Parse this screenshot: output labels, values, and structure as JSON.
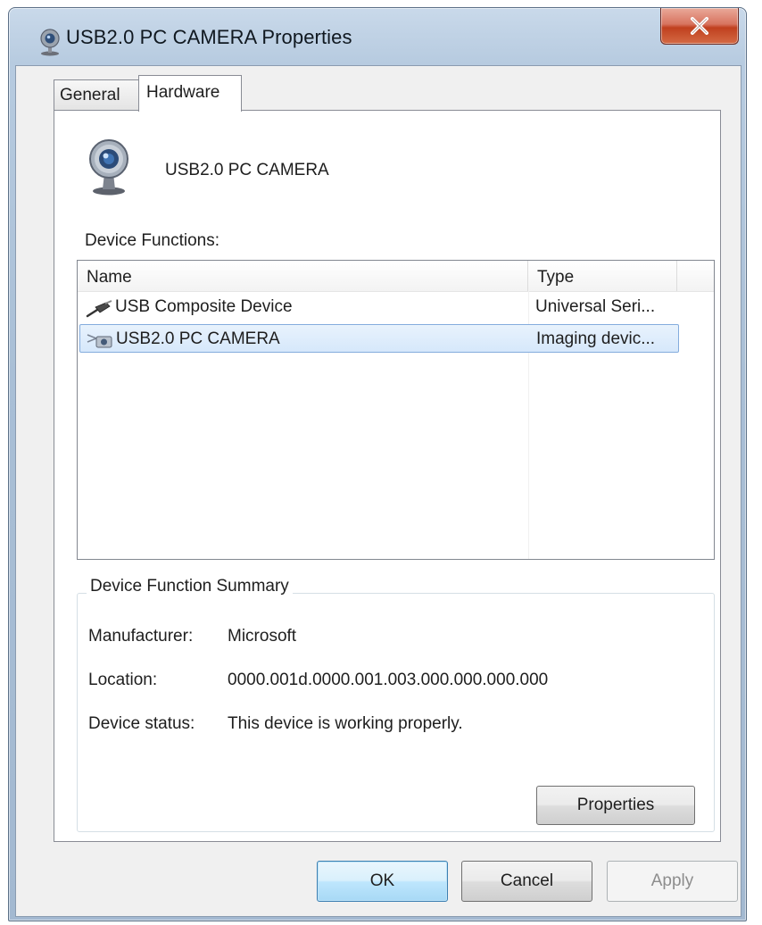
{
  "window": {
    "title": "USB2.0 PC CAMERA Properties",
    "close_label": "X"
  },
  "tabs": [
    {
      "label": "General",
      "active": false
    },
    {
      "label": "Hardware",
      "active": true
    }
  ],
  "device": {
    "name": "USB2.0 PC CAMERA",
    "icon": "webcam-icon"
  },
  "functions": {
    "label": "Device Functions:",
    "columns": [
      "Name",
      "Type"
    ],
    "rows": [
      {
        "name": "USB Composite Device",
        "type": "Universal Seri...",
        "icon": "usb-plug-icon",
        "selected": false
      },
      {
        "name": "USB2.0 PC CAMERA",
        "type": "Imaging devic...",
        "icon": "imaging-device-icon",
        "selected": true
      }
    ]
  },
  "summary": {
    "legend": "Device Function Summary",
    "manufacturer_label": "Manufacturer:",
    "manufacturer_value": "Microsoft",
    "location_label": "Location:",
    "location_value": "0000.001d.0000.001.003.000.000.000.000",
    "status_label": "Device status:",
    "status_value": "This device is working properly.",
    "properties_button": "Properties"
  },
  "buttons": {
    "ok": "OK",
    "cancel": "Cancel",
    "apply": "Apply"
  },
  "colors": {
    "selection": "#d6e8fb",
    "close_button": "#c0401f"
  }
}
